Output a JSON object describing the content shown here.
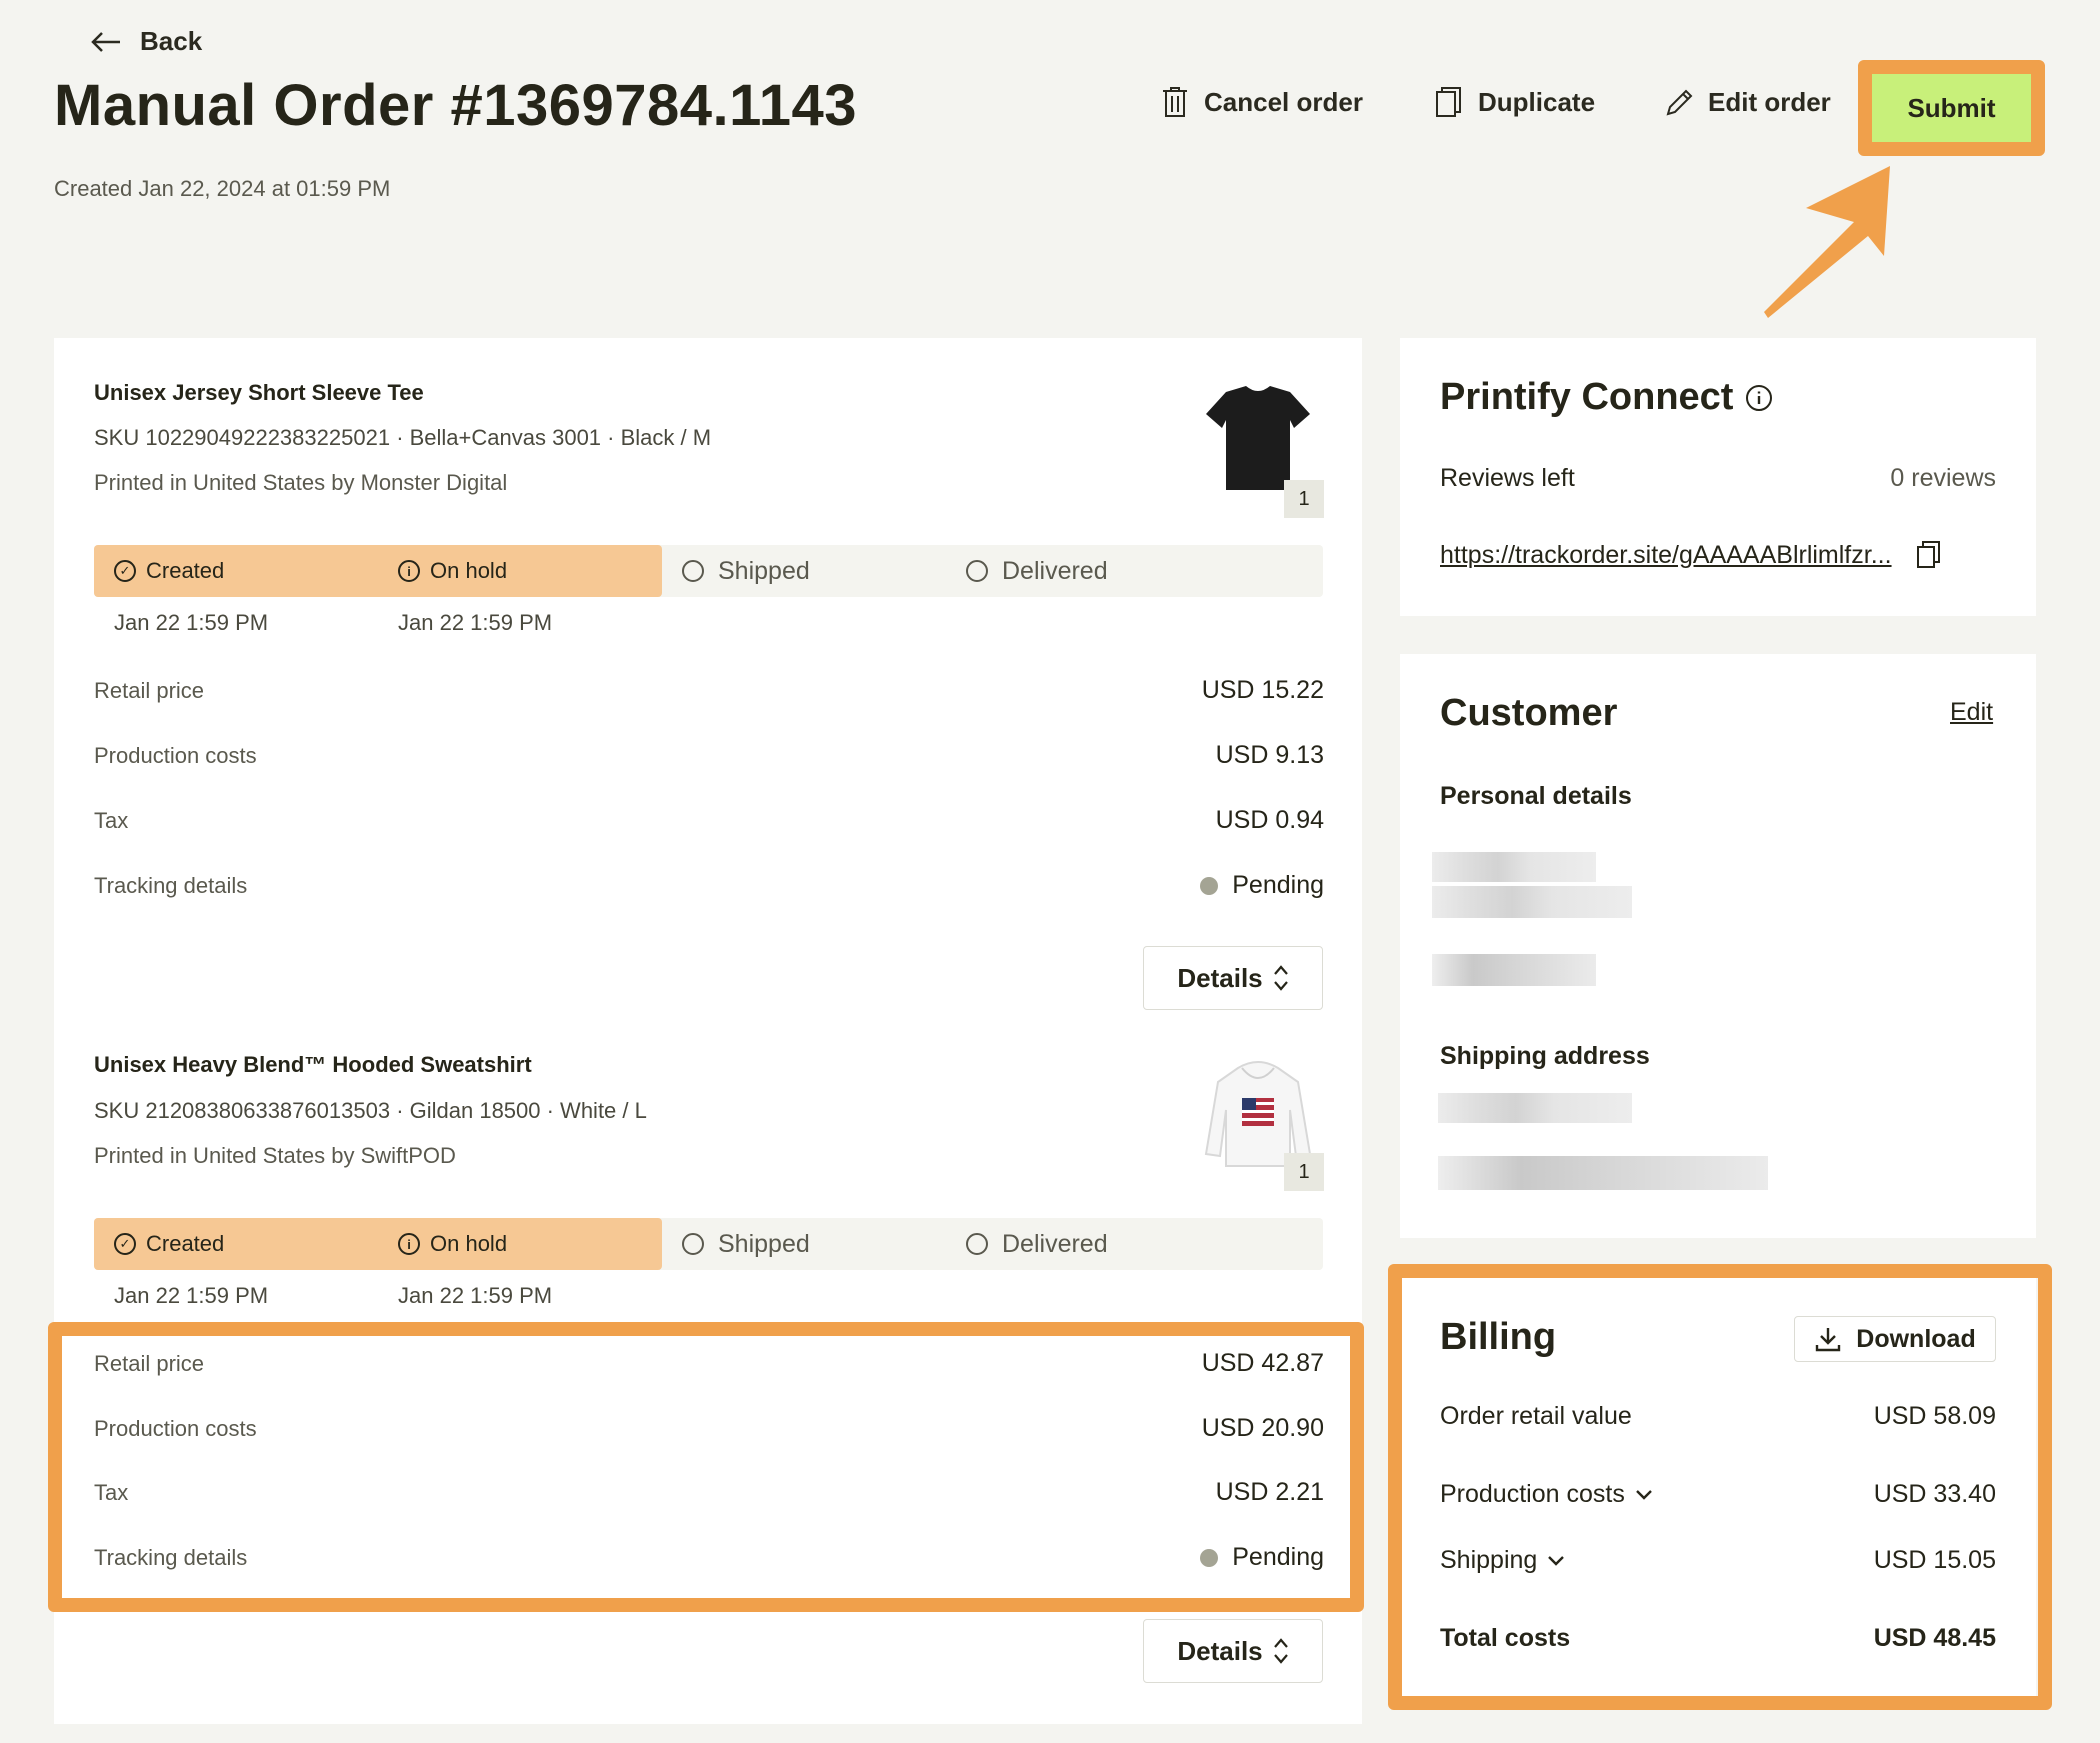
{
  "header": {
    "back_label": "Back",
    "title": "Manual Order #1369784.1143",
    "created": "Created Jan 22, 2024 at 01:59 PM",
    "actions": {
      "cancel": "Cancel order",
      "duplicate": "Duplicate",
      "edit": "Edit order",
      "submit": "Submit"
    }
  },
  "items": [
    {
      "name": "Unisex Jersey Short Sleeve Tee",
      "sku": "SKU 10229049222383225021",
      "variant": "· Bella+Canvas 3001 · Black / M",
      "printed": "Printed in United States by Monster Digital",
      "qty": "1",
      "tracker": {
        "steps": [
          "Created",
          "On hold",
          "Shipped",
          "Delivered"
        ],
        "dates": [
          "Jan 22 1:59 PM",
          "Jan 22 1:59 PM"
        ]
      },
      "retail_label": "Retail price",
      "retail": "USD 15.22",
      "production_label": "Production costs",
      "production": "USD 9.13",
      "tax_label": "Tax",
      "tax": "USD 0.94",
      "tracking_label": "Tracking details",
      "tracking": "Pending",
      "details_label": "Details"
    },
    {
      "name": "Unisex Heavy Blend™ Hooded Sweatshirt",
      "sku": "SKU 21208380633876013503",
      "variant": "· Gildan 18500 · White / L",
      "printed": "Printed in United States by SwiftPOD",
      "qty": "1",
      "tracker": {
        "steps": [
          "Created",
          "On hold",
          "Shipped",
          "Delivered"
        ],
        "dates": [
          "Jan 22 1:59 PM",
          "Jan 22 1:59 PM"
        ]
      },
      "retail_label": "Retail price",
      "retail": "USD 42.87",
      "production_label": "Production costs",
      "production": "USD 20.90",
      "tax_label": "Tax",
      "tax": "USD 2.21",
      "tracking_label": "Tracking details",
      "tracking": "Pending",
      "details_label": "Details"
    }
  ],
  "connect": {
    "title": "Printify Connect",
    "reviews_label": "Reviews left",
    "reviews_value": "0 reviews",
    "link": "https://trackorder.site/gAAAAABlrlimlfzr..."
  },
  "customer": {
    "title": "Customer",
    "edit": "Edit",
    "personal": "Personal details",
    "shipping": "Shipping address"
  },
  "billing": {
    "title": "Billing",
    "download": "Download",
    "order_retail_label": "Order retail value",
    "order_retail": "USD 58.09",
    "production_label": "Production costs",
    "production": "USD 33.40",
    "shipping_label": "Shipping",
    "shipping": "USD 15.05",
    "total_label": "Total costs",
    "total": "USD 48.45"
  },
  "colors": {
    "background": "#f4f4f0",
    "submit": "#c8f07a",
    "highlight": "#f0a04b",
    "tracker_done": "#f6c894"
  }
}
